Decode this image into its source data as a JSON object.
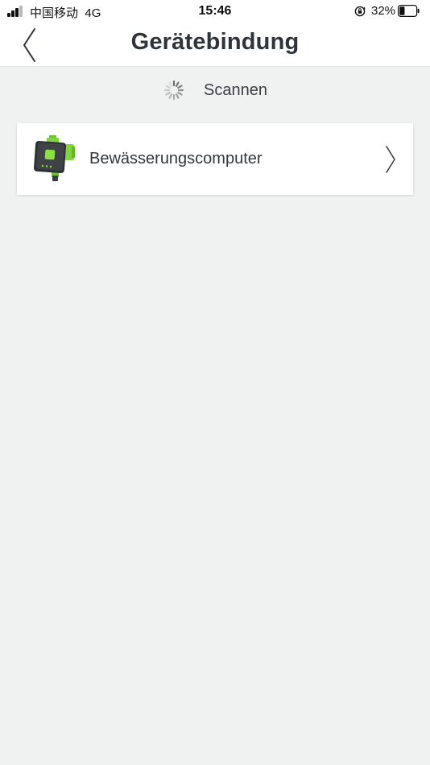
{
  "status_bar": {
    "carrier": "中国移动",
    "network": "4G",
    "time": "15:46",
    "battery_percent": "32%",
    "battery_level": 0.32,
    "icons": [
      "signal-bars-icon",
      "orientation-lock-icon",
      "battery-icon"
    ]
  },
  "nav": {
    "title": "Gerätebindung",
    "back_icon": "chevron-left-icon"
  },
  "scan": {
    "label": "Scannen",
    "icon": "spinner-icon"
  },
  "devices": [
    {
      "name": "Bewässerungscomputer",
      "image_icon": "irrigation-computer-image",
      "action_icon": "chevron-right-icon"
    }
  ],
  "colors": {
    "background": "#f0f1f1",
    "card": "#ffffff",
    "title_text": "#2f343a",
    "device_accent": "#7ed63a",
    "device_body": "#3a3d40"
  }
}
